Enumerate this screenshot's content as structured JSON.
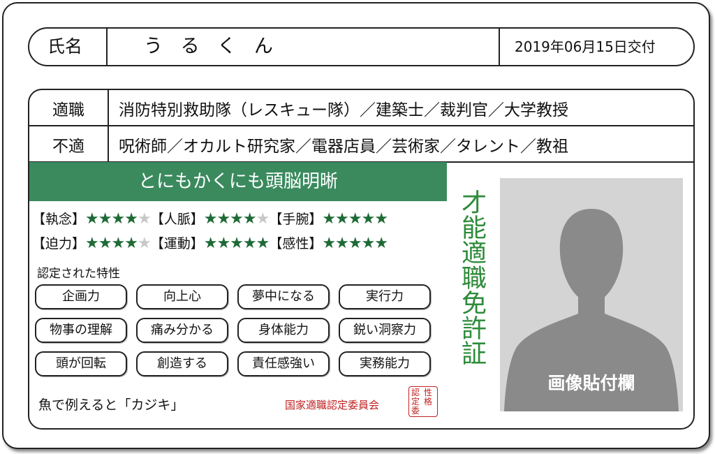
{
  "name_row": {
    "label": "氏名",
    "value": "うるくん",
    "issue_date": "2019年06月15日交付"
  },
  "aptitude": {
    "suitable_label": "適職",
    "suitable_value": "消防特別救助隊（レスキュー隊）／建築士／裁判官／大学教授",
    "unsuitable_label": "不適",
    "unsuitable_value": "呪術師／オカルト研究家／電器店員／芸術家／タレント／教祖"
  },
  "banner": "とにもかくにも頭脳明晰",
  "stats": [
    {
      "label": "【執念】",
      "rating": 4,
      "max": 5
    },
    {
      "label": "【人脈】",
      "rating": 4,
      "max": 5
    },
    {
      "label": "【手腕】",
      "rating": 5,
      "max": 5
    },
    {
      "label": "【迫力】",
      "rating": 4,
      "max": 5
    },
    {
      "label": "【運動】",
      "rating": 5,
      "max": 5
    },
    {
      "label": "【感性】",
      "rating": 5,
      "max": 5
    }
  ],
  "traits_title": "認定された特性",
  "traits": [
    "企画力",
    "向上心",
    "夢中になる",
    "実行力",
    "物事の理解",
    "痛み分かる",
    "身体能力",
    "鋭い洞察力",
    "頭が回転",
    "創造する",
    "責任感強い",
    "実務能力"
  ],
  "fish_text": "魚で例えると「カジキ」",
  "committee": "国家適職認定委員会",
  "seal": [
    "認",
    "性",
    "定",
    "格",
    "委"
  ],
  "vertical_title": "才能適職免許証",
  "photo_label": "画像貼付欄",
  "colors": {
    "accent_green": "#3a8a5e",
    "title_green": "#2e8b3a",
    "seal_red": "#c02020",
    "star_green": "#1e6a36"
  }
}
